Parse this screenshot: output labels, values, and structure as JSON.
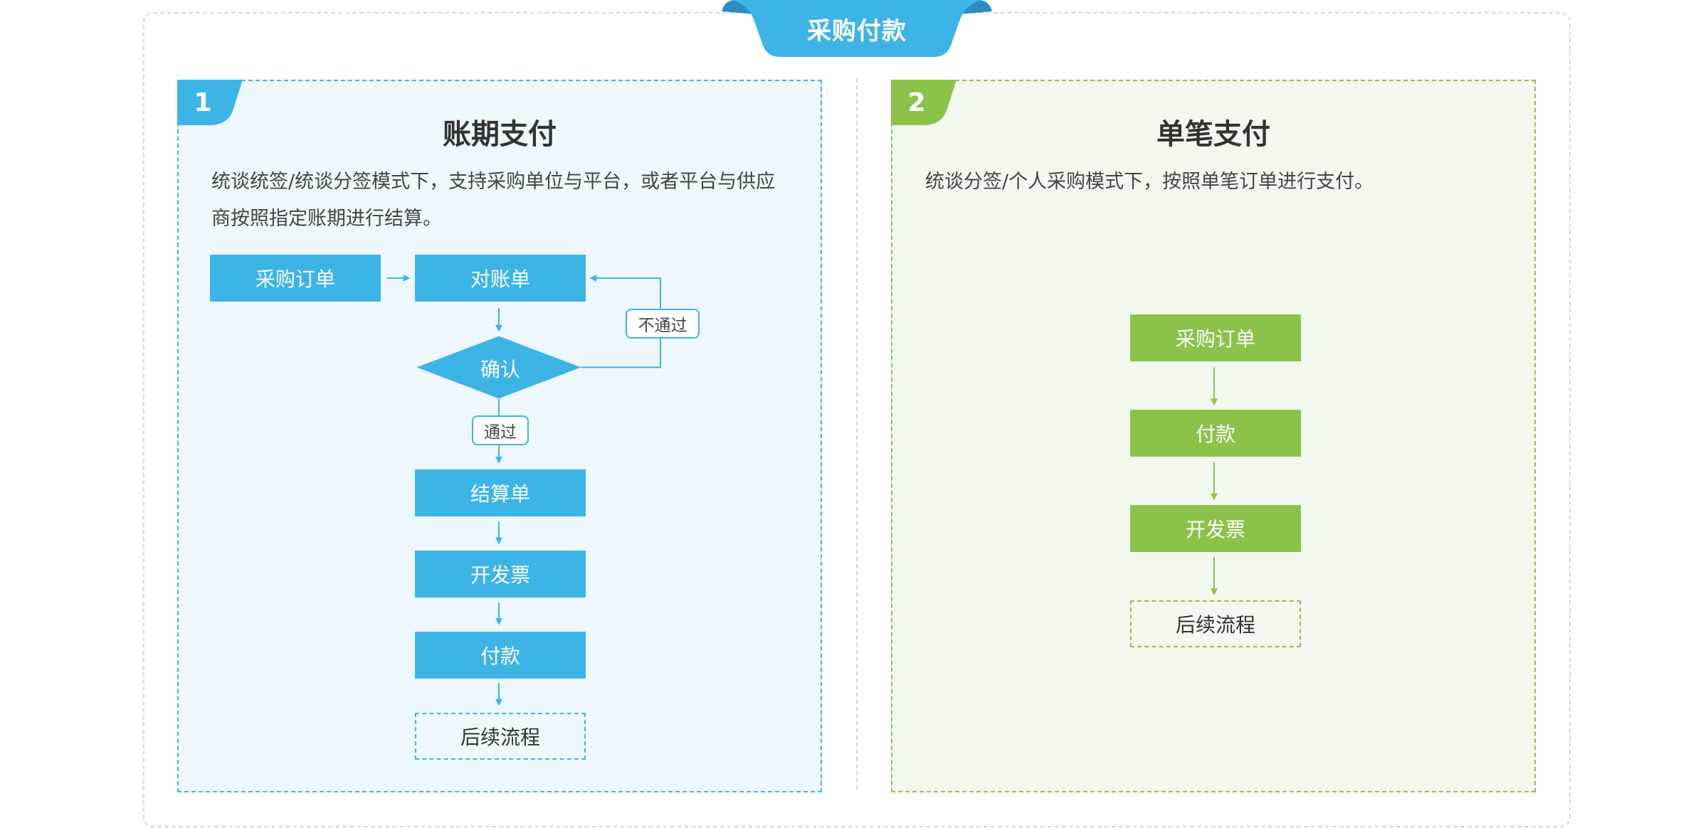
{
  "header": {
    "title": "采购付款",
    "accent": "#3db4e6",
    "accent_dark": "#2a8fc0"
  },
  "panels": [
    {
      "number": "1",
      "title": "账期支付",
      "description": "统谈统签/统谈分签模式下，支持采购单位与平台，或者平台与供应商按照指定账期进行结算。",
      "color": "#3db4e6",
      "flow": {
        "nodes": {
          "purchase_order": "采购订单",
          "statement": "对账单",
          "confirm": "确认",
          "settlement": "结算单",
          "invoice": "开发票",
          "payment": "付款",
          "follow_up": "后续流程"
        },
        "labels": {
          "rejected": "不通过",
          "approved": "通过"
        }
      }
    },
    {
      "number": "2",
      "title": "单笔支付",
      "description": "统谈分签/个人采购模式下，按照单笔订单进行支付。",
      "color": "#8bc34a",
      "flow": {
        "nodes": {
          "purchase_order": "采购订单",
          "payment": "付款",
          "invoice": "开发票",
          "follow_up": "后续流程"
        }
      }
    }
  ]
}
